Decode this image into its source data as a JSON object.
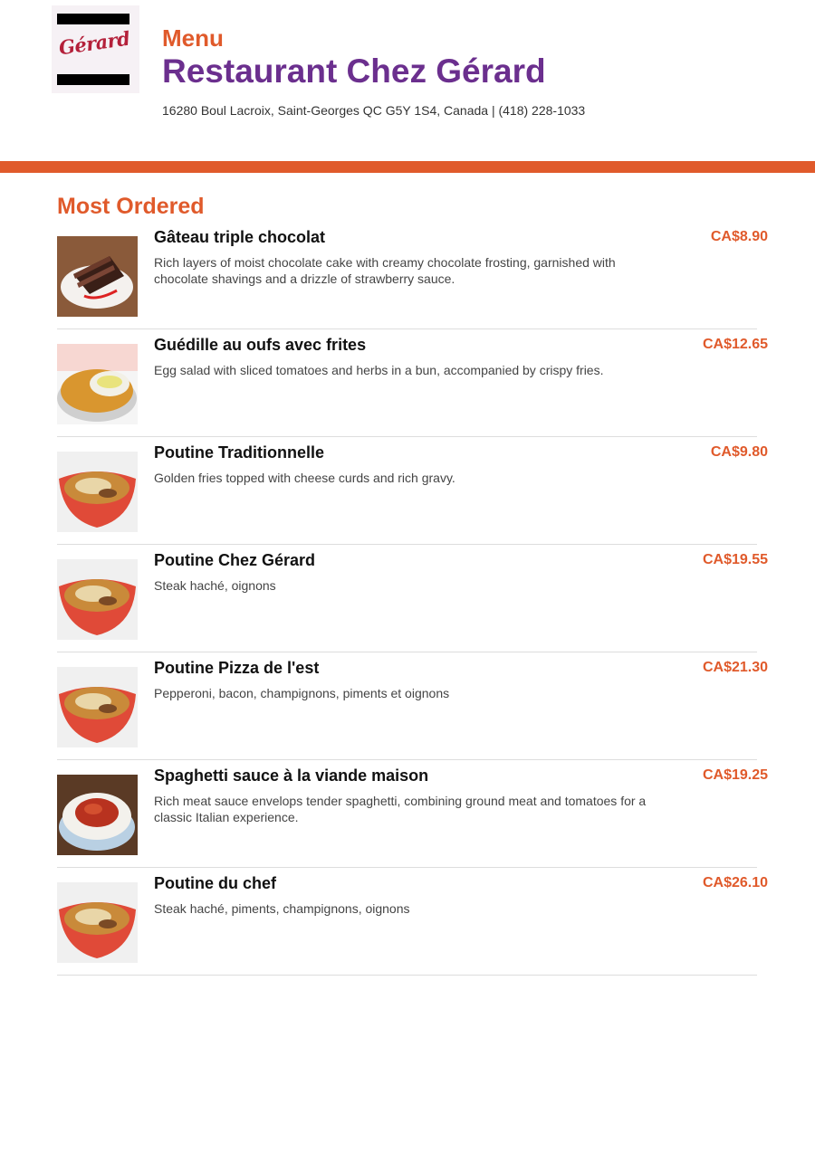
{
  "header": {
    "logo_text": "Gérard",
    "menu_label": "Menu",
    "restaurant_name": "Restaurant Chez Gérard",
    "address": "16280 Boul Lacroix, Saint-Georges QC G5Y 1S4, Canada | (418) 228-1033"
  },
  "colors": {
    "accent": "#e05a2b",
    "brand_purple": "#6b2f8e"
  },
  "section": {
    "title": "Most Ordered"
  },
  "items": [
    {
      "name": "Gâteau triple chocolat",
      "description": "Rich layers of moist chocolate cake with creamy chocolate frosting, garnished with chocolate shavings and a drizzle of strawberry sauce.",
      "price": "CA$8.90",
      "image": "chocolate-cake"
    },
    {
      "name": "Guédille au oufs avec frites",
      "description": "Egg salad with sliced tomatoes and herbs in a bun, accompanied by crispy fries.",
      "price": "CA$12.65",
      "image": "egg-sandwich-fries"
    },
    {
      "name": "Poutine Traditionnelle",
      "description": "Golden fries topped with cheese curds and rich gravy.",
      "price": "CA$9.80",
      "image": "poutine-bowl"
    },
    {
      "name": "Poutine Chez Gérard",
      "description": "Steak haché, oignons",
      "price": "CA$19.55",
      "image": "poutine-bowl"
    },
    {
      "name": "Poutine Pizza de l'est",
      "description": "Pepperoni, bacon, champignons, piments et oignons",
      "price": "CA$21.30",
      "image": "poutine-bowl"
    },
    {
      "name": "Spaghetti sauce à la viande maison",
      "description": "Rich meat sauce envelops tender spaghetti, combining ground meat and tomatoes for a classic Italian experience.",
      "price": "CA$19.25",
      "image": "spaghetti-plate"
    },
    {
      "name": "Poutine du chef",
      "description": "Steak haché, piments, champignons, oignons",
      "price": "CA$26.10",
      "image": "poutine-bowl"
    }
  ]
}
